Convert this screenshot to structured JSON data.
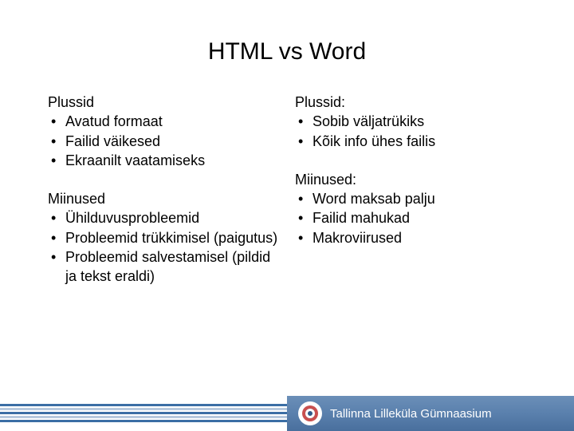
{
  "title": "HTML vs Word",
  "left": {
    "pros_heading": "Plussid",
    "pros": [
      "Avatud formaat",
      "Failid väikesed",
      "Ekraanilt vaatamiseks"
    ],
    "cons_heading": "Miinused",
    "cons": [
      "Ühilduvusprobleemid",
      "Probleemid trükkimisel (paigutus)",
      "Probleemid salvestamisel (pildid ja tekst eraldi)"
    ]
  },
  "right": {
    "pros_heading": "Plussid:",
    "pros": [
      "Sobib väljatrükiks",
      "Kõik info ühes failis"
    ],
    "cons_heading": "Miinused:",
    "cons": [
      "Word maksab palju",
      "Failid mahukad",
      "Makroviirused"
    ]
  },
  "footer": {
    "org_name": "Tallinna Lilleküla Gümnaasium"
  }
}
